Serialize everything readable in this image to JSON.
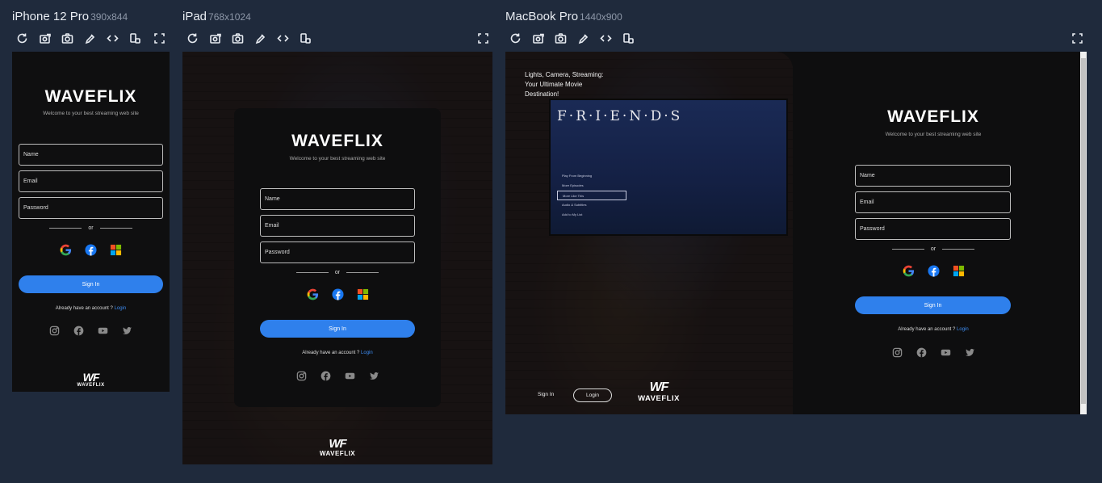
{
  "devices": {
    "iphone": {
      "name": "iPhone 12 Pro",
      "dims": "390x844"
    },
    "ipad": {
      "name": "iPad",
      "dims": "768x1024"
    },
    "macbook": {
      "name": "MacBook Pro",
      "dims": "1440x900"
    }
  },
  "toolbar_icons": [
    "refresh-icon",
    "screenshot-region-icon",
    "camera-icon",
    "eyedropper-icon",
    "code-icon",
    "rotate-device-icon",
    "fullscreen-icon"
  ],
  "form": {
    "brand": "WAVEFLIX",
    "tagline": "Welcome to your best streaming web site",
    "name_placeholder": "Name",
    "email_placeholder": "Email",
    "password_placeholder": "Password",
    "or": "or",
    "signin_label": "Sign In",
    "have_account": "Already have an account ?",
    "login_link": "Login"
  },
  "logo": {
    "mark": "WF",
    "name": "WAVEFLIX"
  },
  "hero": {
    "line1": "Lights, Camera, Streaming:",
    "line2": "Your Ultimate Movie",
    "line3": "Destination!"
  },
  "tv": {
    "title": "F·R·I·E·N·D·S",
    "menu": [
      "Play From Beginning",
      "More Episodes",
      "More Like This",
      "Audio & Subtitles",
      "Add to My List"
    ]
  },
  "auth_nav": {
    "signin": "Sign In",
    "login": "Login"
  },
  "social": [
    "google-icon",
    "facebook-icon",
    "microsoft-icon"
  ],
  "footer_social": [
    "instagram-icon",
    "facebook-icon",
    "youtube-icon",
    "twitter-icon"
  ],
  "colors": {
    "accent": "#2f80ec",
    "bg": "#1f2a3c",
    "card": "#0e0e0f"
  }
}
